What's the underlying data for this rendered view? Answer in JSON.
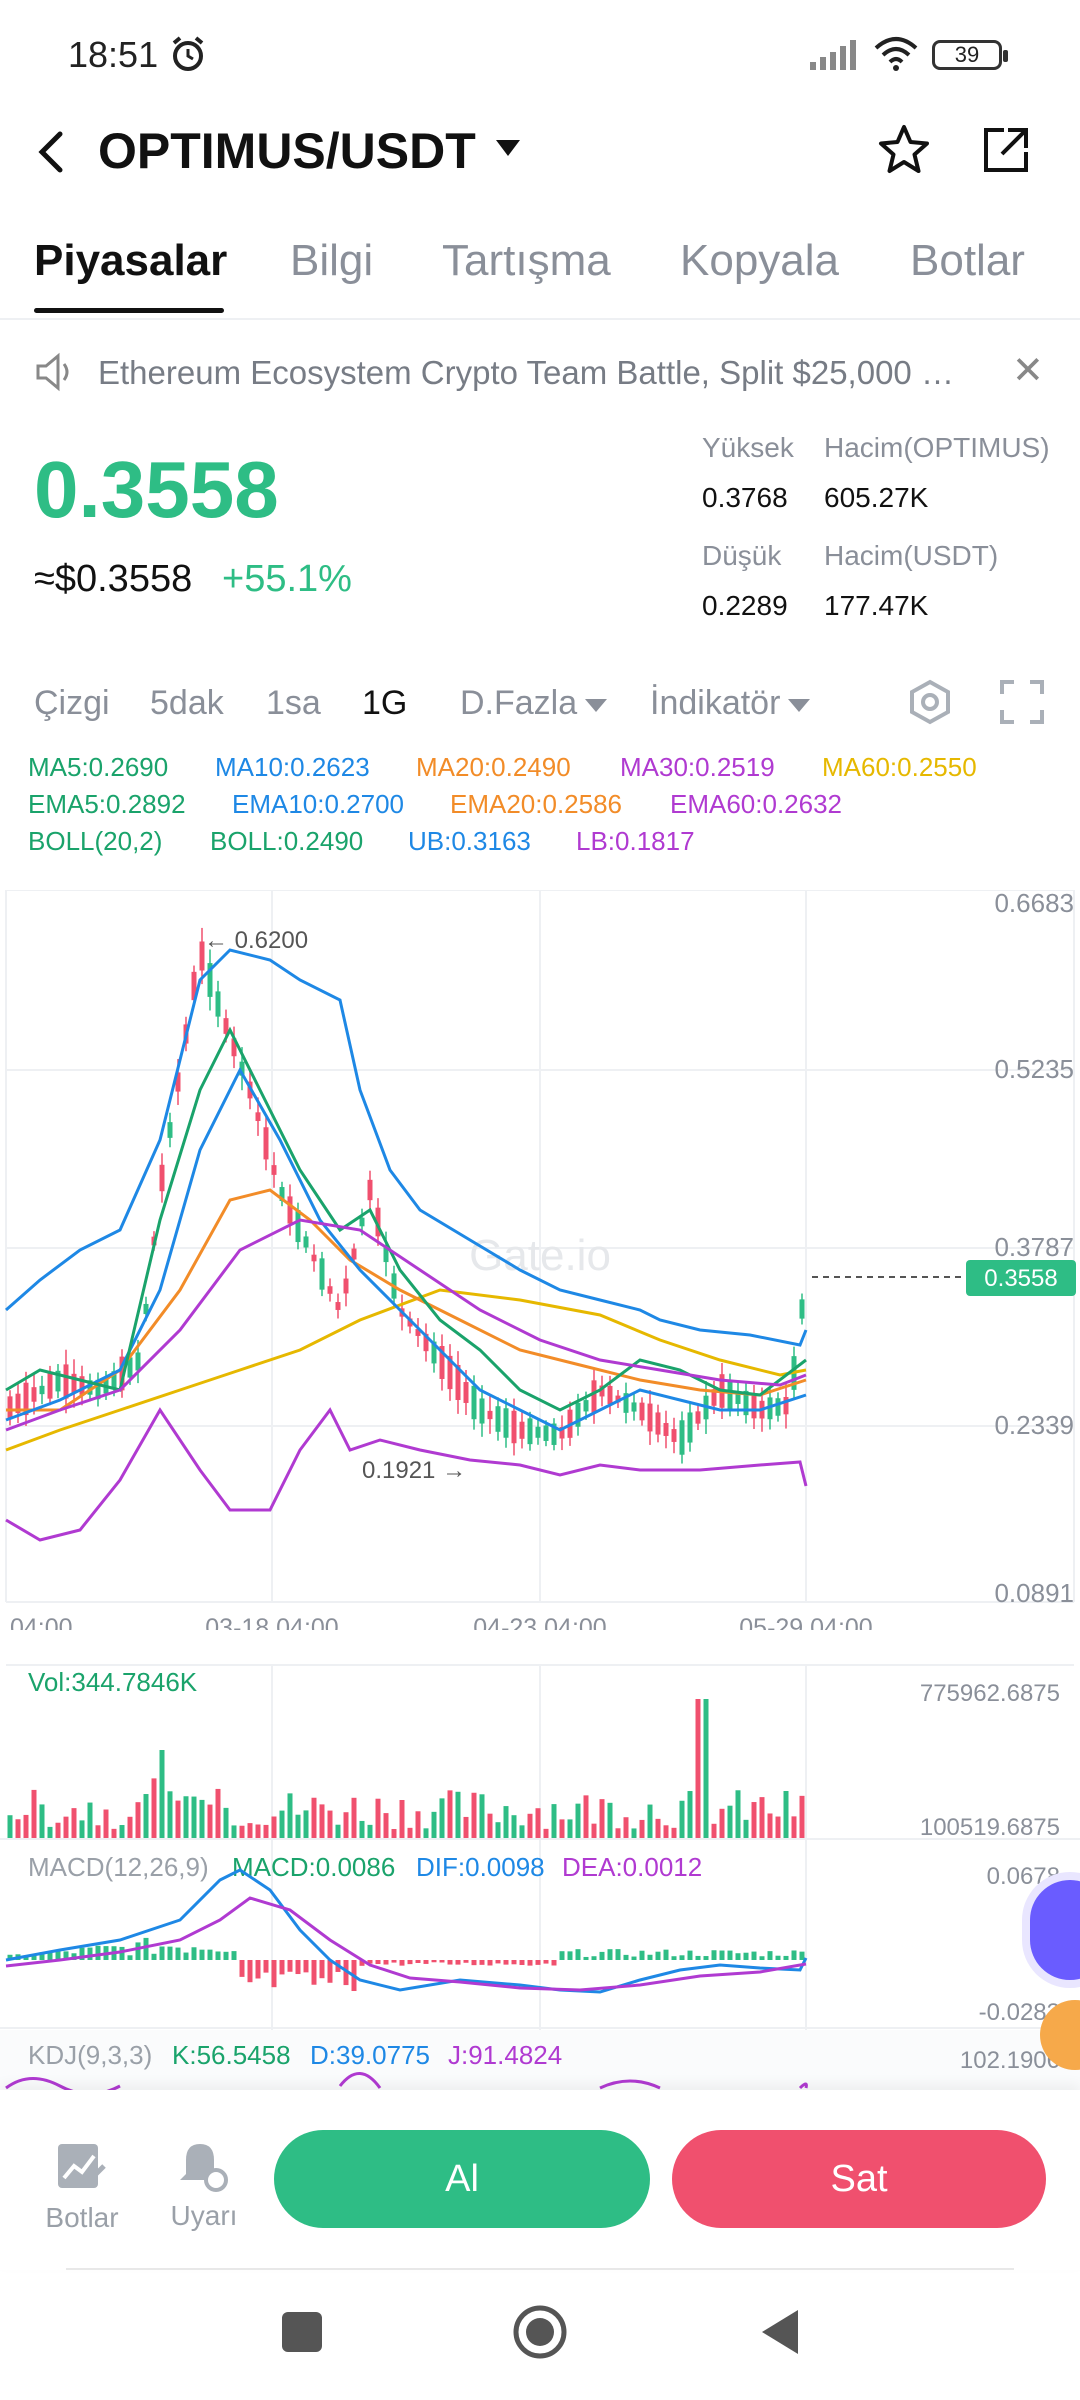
{
  "status_bar": {
    "time": "18:51",
    "battery": "39"
  },
  "header": {
    "pair": "OPTIMUS/USDT"
  },
  "tabs": [
    {
      "label": "Piyasalar",
      "active": true
    },
    {
      "label": "Bilgi"
    },
    {
      "label": "Tartışma"
    },
    {
      "label": "Kopyala"
    },
    {
      "label": "Botlar"
    }
  ],
  "announcement": {
    "text": "Ethereum Ecosystem Crypto Team Battle, Split $25,000 …"
  },
  "ticker": {
    "last_price": "0.3558",
    "usd_price": "≈$0.3558",
    "change": "+55.1%",
    "high_label": "Yüksek",
    "high_value": "0.3768",
    "vol_base_label": "Hacim(OPTIMUS)",
    "vol_base_value": "605.27K",
    "low_label": "Düşük",
    "low_value": "0.2289",
    "vol_quote_label": "Hacim(USDT)",
    "vol_quote_value": "177.47K"
  },
  "toolbar": {
    "line": "Çizgi",
    "m5": "5dak",
    "h1": "1sa",
    "d1": "1G",
    "more": "D.Fazla",
    "indicator": "İndikatör"
  },
  "indicators": {
    "ma5": "MA5:0.2690",
    "ma10": "MA10:0.2623",
    "ma20": "MA20:0.2490",
    "ma30": "MA30:0.2519",
    "ma60": "MA60:0.2550",
    "ema5": "EMA5:0.2892",
    "ema10": "EMA10:0.2700",
    "ema20": "EMA20:0.2586",
    "ema60": "EMA60:0.2632",
    "boll_title": "BOLL(20,2)",
    "boll": "BOLL:0.2490",
    "ub": "UB:0.3163",
    "lb": "LB:0.1817"
  },
  "main_chart": {
    "y_ticks": [
      "0.6683",
      "0.5235",
      "0.3787",
      "0.2339",
      "0.0891"
    ],
    "x_ticks": [
      "04:00",
      "03-18 04:00",
      "04-23 04:00",
      "05-29 04:00"
    ],
    "max_label": "← 0.6200",
    "min_label": "0.1921 →",
    "current_price_tag": "0.3558",
    "watermark": "Gate.io"
  },
  "volume": {
    "label": "Vol:344.7846K",
    "top": "775962.6875",
    "bottom": "100519.6875"
  },
  "macd": {
    "title": "MACD(12,26,9)",
    "macd": "MACD:0.0086",
    "dif": "DIF:0.0098",
    "dea": "DEA:0.0012",
    "top": "0.0678",
    "bottom": "-0.0283"
  },
  "kdj": {
    "title": "KDJ(9,3,3)",
    "k": "K:56.5458",
    "d": "D:39.0775",
    "j": "J:91.4824",
    "top": "102.1906"
  },
  "bottom_bar": {
    "bots": "Botlar",
    "alerts": "Uyarı",
    "buy": "Al",
    "sell": "Sat"
  },
  "colors": {
    "up": "#2ebd85",
    "down": "#f0506e",
    "ma5": "#1aa36b",
    "ma10": "#1e88e5",
    "ma20": "#f28c28",
    "ma30": "#b03ad1",
    "ma60": "#e6b800"
  }
}
